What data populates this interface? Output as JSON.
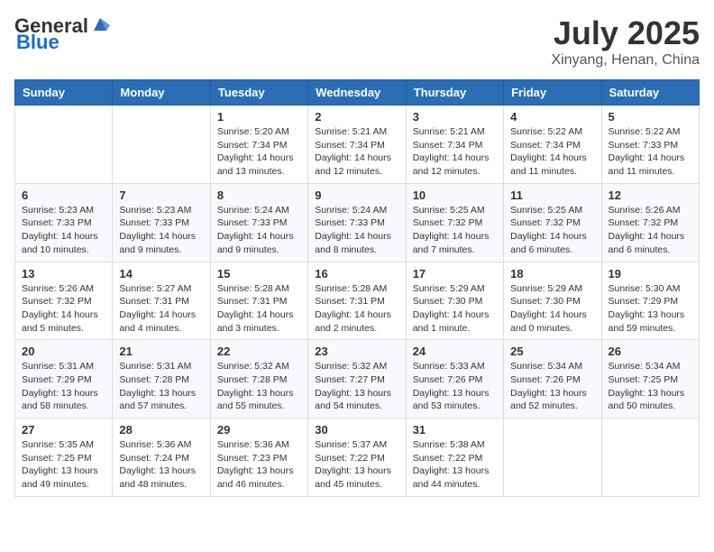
{
  "header": {
    "logo_general": "General",
    "logo_blue": "Blue",
    "month": "July 2025",
    "location": "Xinyang, Henan, China"
  },
  "weekdays": [
    "Sunday",
    "Monday",
    "Tuesday",
    "Wednesday",
    "Thursday",
    "Friday",
    "Saturday"
  ],
  "weeks": [
    [
      {
        "day": "",
        "sunrise": "",
        "sunset": "",
        "daylight": ""
      },
      {
        "day": "",
        "sunrise": "",
        "sunset": "",
        "daylight": ""
      },
      {
        "day": "1",
        "sunrise": "Sunrise: 5:20 AM",
        "sunset": "Sunset: 7:34 PM",
        "daylight": "Daylight: 14 hours and 13 minutes."
      },
      {
        "day": "2",
        "sunrise": "Sunrise: 5:21 AM",
        "sunset": "Sunset: 7:34 PM",
        "daylight": "Daylight: 14 hours and 12 minutes."
      },
      {
        "day": "3",
        "sunrise": "Sunrise: 5:21 AM",
        "sunset": "Sunset: 7:34 PM",
        "daylight": "Daylight: 14 hours and 12 minutes."
      },
      {
        "day": "4",
        "sunrise": "Sunrise: 5:22 AM",
        "sunset": "Sunset: 7:34 PM",
        "daylight": "Daylight: 14 hours and 11 minutes."
      },
      {
        "day": "5",
        "sunrise": "Sunrise: 5:22 AM",
        "sunset": "Sunset: 7:33 PM",
        "daylight": "Daylight: 14 hours and 11 minutes."
      }
    ],
    [
      {
        "day": "6",
        "sunrise": "Sunrise: 5:23 AM",
        "sunset": "Sunset: 7:33 PM",
        "daylight": "Daylight: 14 hours and 10 minutes."
      },
      {
        "day": "7",
        "sunrise": "Sunrise: 5:23 AM",
        "sunset": "Sunset: 7:33 PM",
        "daylight": "Daylight: 14 hours and 9 minutes."
      },
      {
        "day": "8",
        "sunrise": "Sunrise: 5:24 AM",
        "sunset": "Sunset: 7:33 PM",
        "daylight": "Daylight: 14 hours and 9 minutes."
      },
      {
        "day": "9",
        "sunrise": "Sunrise: 5:24 AM",
        "sunset": "Sunset: 7:33 PM",
        "daylight": "Daylight: 14 hours and 8 minutes."
      },
      {
        "day": "10",
        "sunrise": "Sunrise: 5:25 AM",
        "sunset": "Sunset: 7:32 PM",
        "daylight": "Daylight: 14 hours and 7 minutes."
      },
      {
        "day": "11",
        "sunrise": "Sunrise: 5:25 AM",
        "sunset": "Sunset: 7:32 PM",
        "daylight": "Daylight: 14 hours and 6 minutes."
      },
      {
        "day": "12",
        "sunrise": "Sunrise: 5:26 AM",
        "sunset": "Sunset: 7:32 PM",
        "daylight": "Daylight: 14 hours and 6 minutes."
      }
    ],
    [
      {
        "day": "13",
        "sunrise": "Sunrise: 5:26 AM",
        "sunset": "Sunset: 7:32 PM",
        "daylight": "Daylight: 14 hours and 5 minutes."
      },
      {
        "day": "14",
        "sunrise": "Sunrise: 5:27 AM",
        "sunset": "Sunset: 7:31 PM",
        "daylight": "Daylight: 14 hours and 4 minutes."
      },
      {
        "day": "15",
        "sunrise": "Sunrise: 5:28 AM",
        "sunset": "Sunset: 7:31 PM",
        "daylight": "Daylight: 14 hours and 3 minutes."
      },
      {
        "day": "16",
        "sunrise": "Sunrise: 5:28 AM",
        "sunset": "Sunset: 7:31 PM",
        "daylight": "Daylight: 14 hours and 2 minutes."
      },
      {
        "day": "17",
        "sunrise": "Sunrise: 5:29 AM",
        "sunset": "Sunset: 7:30 PM",
        "daylight": "Daylight: 14 hours and 1 minute."
      },
      {
        "day": "18",
        "sunrise": "Sunrise: 5:29 AM",
        "sunset": "Sunset: 7:30 PM",
        "daylight": "Daylight: 14 hours and 0 minutes."
      },
      {
        "day": "19",
        "sunrise": "Sunrise: 5:30 AM",
        "sunset": "Sunset: 7:29 PM",
        "daylight": "Daylight: 13 hours and 59 minutes."
      }
    ],
    [
      {
        "day": "20",
        "sunrise": "Sunrise: 5:31 AM",
        "sunset": "Sunset: 7:29 PM",
        "daylight": "Daylight: 13 hours and 58 minutes."
      },
      {
        "day": "21",
        "sunrise": "Sunrise: 5:31 AM",
        "sunset": "Sunset: 7:28 PM",
        "daylight": "Daylight: 13 hours and 57 minutes."
      },
      {
        "day": "22",
        "sunrise": "Sunrise: 5:32 AM",
        "sunset": "Sunset: 7:28 PM",
        "daylight": "Daylight: 13 hours and 55 minutes."
      },
      {
        "day": "23",
        "sunrise": "Sunrise: 5:32 AM",
        "sunset": "Sunset: 7:27 PM",
        "daylight": "Daylight: 13 hours and 54 minutes."
      },
      {
        "day": "24",
        "sunrise": "Sunrise: 5:33 AM",
        "sunset": "Sunset: 7:26 PM",
        "daylight": "Daylight: 13 hours and 53 minutes."
      },
      {
        "day": "25",
        "sunrise": "Sunrise: 5:34 AM",
        "sunset": "Sunset: 7:26 PM",
        "daylight": "Daylight: 13 hours and 52 minutes."
      },
      {
        "day": "26",
        "sunrise": "Sunrise: 5:34 AM",
        "sunset": "Sunset: 7:25 PM",
        "daylight": "Daylight: 13 hours and 50 minutes."
      }
    ],
    [
      {
        "day": "27",
        "sunrise": "Sunrise: 5:35 AM",
        "sunset": "Sunset: 7:25 PM",
        "daylight": "Daylight: 13 hours and 49 minutes."
      },
      {
        "day": "28",
        "sunrise": "Sunrise: 5:36 AM",
        "sunset": "Sunset: 7:24 PM",
        "daylight": "Daylight: 13 hours and 48 minutes."
      },
      {
        "day": "29",
        "sunrise": "Sunrise: 5:36 AM",
        "sunset": "Sunset: 7:23 PM",
        "daylight": "Daylight: 13 hours and 46 minutes."
      },
      {
        "day": "30",
        "sunrise": "Sunrise: 5:37 AM",
        "sunset": "Sunset: 7:22 PM",
        "daylight": "Daylight: 13 hours and 45 minutes."
      },
      {
        "day": "31",
        "sunrise": "Sunrise: 5:38 AM",
        "sunset": "Sunset: 7:22 PM",
        "daylight": "Daylight: 13 hours and 44 minutes."
      },
      {
        "day": "",
        "sunrise": "",
        "sunset": "",
        "daylight": ""
      },
      {
        "day": "",
        "sunrise": "",
        "sunset": "",
        "daylight": ""
      }
    ]
  ]
}
